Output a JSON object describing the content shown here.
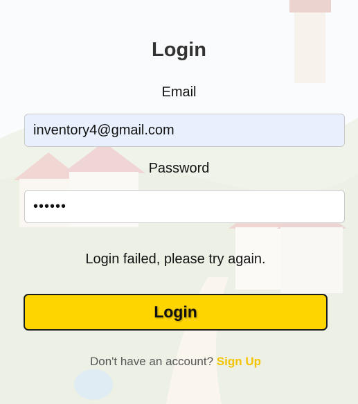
{
  "form": {
    "title": "Login",
    "email_label": "Email",
    "email_value": "inventory4@gmail.com",
    "password_label": "Password",
    "password_value": "••••••",
    "error_message": "Login failed, please try again.",
    "login_button": "Login",
    "signup_prompt": "Don't have an account?",
    "signup_link": "Sign Up"
  },
  "colors": {
    "button": "#ffd500",
    "link": "#f5c400",
    "email_autofill_bg": "#e8f0fe"
  }
}
